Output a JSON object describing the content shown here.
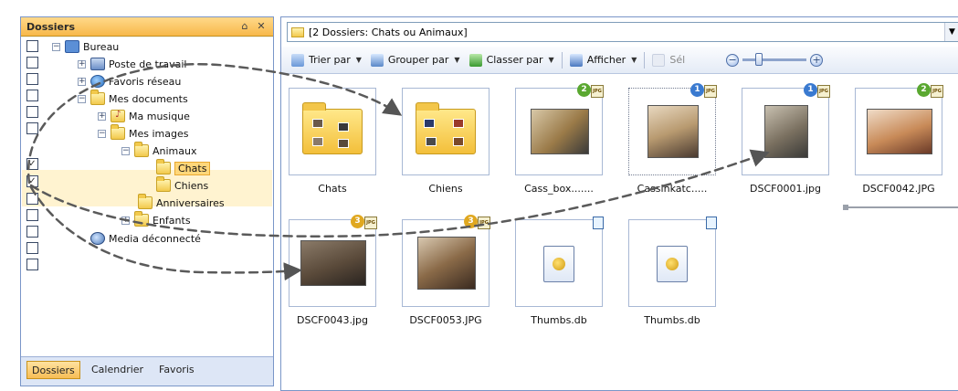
{
  "left_panel": {
    "title": "Dossiers",
    "pin_symbol": "⌂",
    "close_symbol": "✕",
    "tree": [
      {
        "label": "Bureau",
        "icon": "desktop-icon",
        "expander": "−",
        "checked": ""
      },
      {
        "label": "Poste de travail",
        "icon": "computer-icon",
        "expander": "+",
        "checked": ""
      },
      {
        "label": "Favoris réseau",
        "icon": "network-icon",
        "expander": "+",
        "checked": ""
      },
      {
        "label": "Mes documents",
        "icon": "folder-icon",
        "expander": "−",
        "checked": ""
      },
      {
        "label": "Ma musique",
        "icon": "music-folder-icon",
        "expander": "+",
        "checked": ""
      },
      {
        "label": "Mes images",
        "icon": "folder-icon",
        "expander": "−",
        "checked": ""
      },
      {
        "label": "Animaux",
        "icon": "folder-icon",
        "expander": "−",
        "checked": "✓"
      },
      {
        "label": "Chats",
        "icon": "folder-icon",
        "expander": "",
        "checked": "✓"
      },
      {
        "label": "Chiens",
        "icon": "folder-icon",
        "expander": "",
        "checked": ""
      },
      {
        "label": "Anniversaires",
        "icon": "folder-icon",
        "expander": "",
        "checked": ""
      },
      {
        "label": "Enfants",
        "icon": "folder-icon",
        "expander": "+",
        "checked": ""
      },
      {
        "label": "Media déconnecté",
        "icon": "media-icon",
        "expander": "",
        "checked": ""
      }
    ],
    "tabs": [
      "Dossiers",
      "Calendrier",
      "Favoris"
    ],
    "active_tab": "Dossiers"
  },
  "right_panel": {
    "address": "[2 Dossiers: Chats ou Animaux]",
    "address_dropdown": "▼",
    "toolbar": {
      "sort": "Trier par",
      "group": "Grouper par",
      "classify": "Classer par",
      "view": "Afficher",
      "select": "Sél",
      "dropdown_symbol": "▼",
      "zoom_out": "−",
      "zoom_in": "+"
    },
    "files": [
      {
        "name": "Chats",
        "type": "folder"
      },
      {
        "name": "Chiens",
        "type": "folder"
      },
      {
        "name": "Cass_box.......",
        "type": "image",
        "badge": "2",
        "badge_type": "JPG"
      },
      {
        "name": "Cassinkatc.....",
        "type": "image",
        "badge": "1",
        "badge_type": "JPG"
      },
      {
        "name": "DSCF0001.jpg",
        "type": "image",
        "badge": "1",
        "badge_type": "JPG"
      },
      {
        "name": "DSCF0042.JPG",
        "type": "image",
        "badge": "2",
        "badge_type": "JPG"
      },
      {
        "name": "DSCF0043.jpg",
        "type": "image",
        "badge": "3",
        "badge_type": "JPG"
      },
      {
        "name": "DSCF0053.JPG",
        "type": "image",
        "badge": "3",
        "badge_type": "JPG"
      },
      {
        "name": "Thumbs.db",
        "type": "db"
      },
      {
        "name": "Thumbs.db",
        "type": "db"
      }
    ]
  },
  "colors": {
    "accent_orange": "#f7b84a",
    "panel_border": "#7a96c8",
    "badge_green": "#5aa830",
    "badge_blue": "#3a7ad0",
    "badge_gold": "#e0a820"
  }
}
